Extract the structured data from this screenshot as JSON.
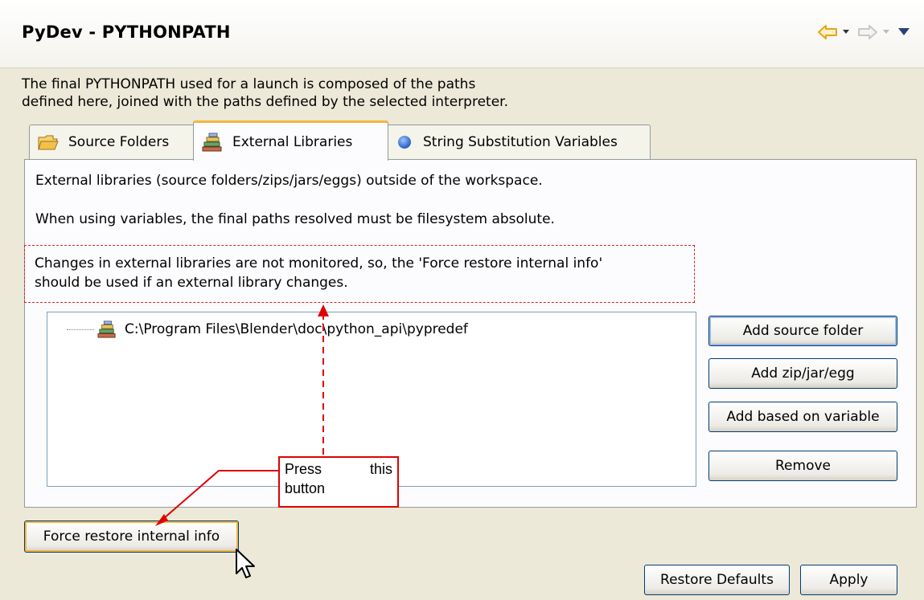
{
  "header": {
    "title": "PyDev - PYTHONPATH"
  },
  "description": {
    "line1": "The final PYTHONPATH used for a launch is composed of the paths",
    "line2": "defined here, joined with the paths defined by the selected interpreter."
  },
  "tabs": [
    {
      "label": "Source Folders"
    },
    {
      "label": "External Libraries"
    },
    {
      "label": "String Substitution Variables"
    }
  ],
  "panel": {
    "text1": "External libraries (source folders/zips/jars/eggs) outside of the workspace.",
    "text2": "When using variables, the final paths resolved must be filesystem absolute.",
    "notice_line1": "Changes in external libraries are not monitored, so, the 'Force restore internal info'",
    "notice_line2": "should be used if an external library changes.",
    "tree_items": [
      {
        "label": "C:\\Program Files\\Blender\\doc\\python_api\\pypredef"
      }
    ],
    "buttons": {
      "add_source_folder": "Add source folder",
      "add_zip": "Add zip/jar/egg",
      "add_variable": "Add based on variable",
      "remove": "Remove"
    }
  },
  "force_restore_label": "Force restore internal info",
  "callout": {
    "word1": "Press",
    "word2": "this",
    "word3": "button"
  },
  "footer": {
    "restore_defaults": "Restore Defaults",
    "apply": "Apply"
  },
  "icons": {
    "back": "arrow-left-icon",
    "forward": "arrow-right-icon",
    "menu": "triangle-down-icon",
    "source_folders": "folder-icon",
    "external_libraries": "library-icon",
    "string_substitution": "blue-dot-icon"
  },
  "colors": {
    "callout_red": "#e00000",
    "tab_accent": "#f7b43a",
    "back_arrow": "#e8a317"
  }
}
